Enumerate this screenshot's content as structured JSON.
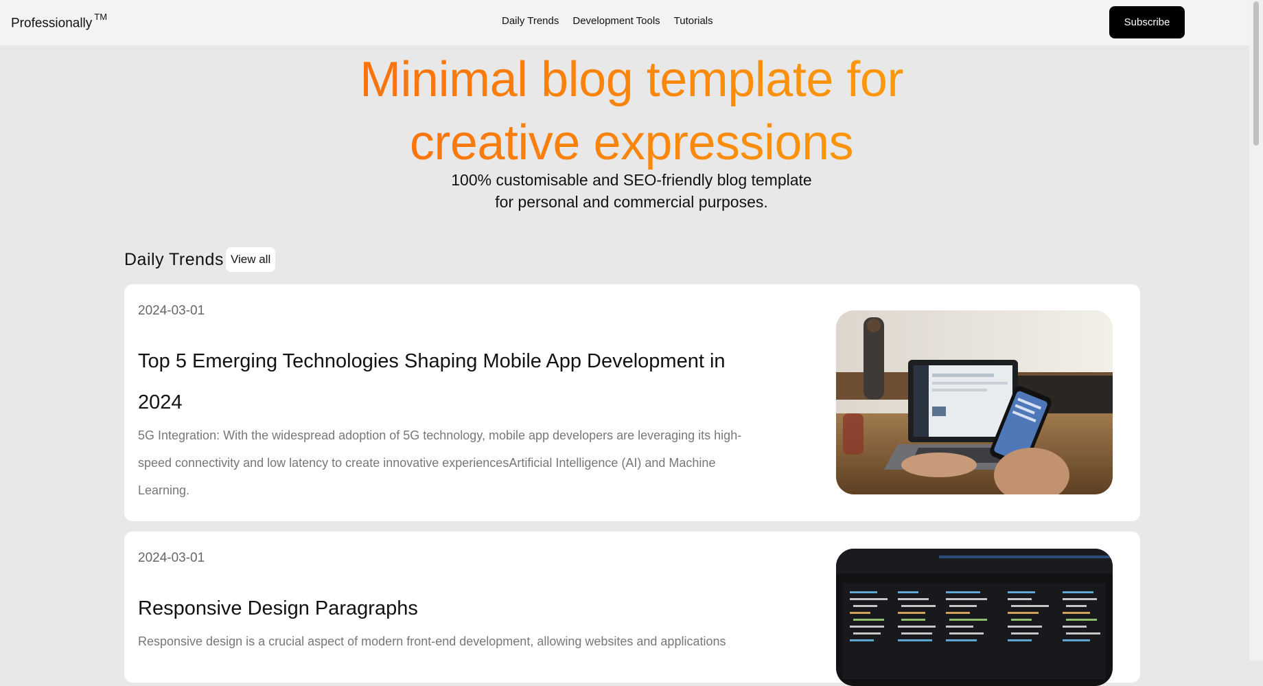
{
  "nav": {
    "brand": "Professionally",
    "brand_mark": "TM",
    "links": [
      "Daily Trends",
      "Development Tools",
      "Tutorials"
    ],
    "subscribe_label": "Subscribe"
  },
  "hero": {
    "title_line1": "Minimal blog template for",
    "title_line2": "creative expressions",
    "subtitle_line1": "100% customisable and SEO-friendly blog template",
    "subtitle_line2": "for personal and commercial purposes."
  },
  "section": {
    "title": "Daily Trends",
    "view_all_label": "View all"
  },
  "posts": [
    {
      "date": "2024-03-01",
      "title": "Top 5 Emerging Technologies Shaping Mobile App Development in 2024",
      "excerpt": "5G Integration: With the widespread adoption of 5G technology, mobile app developers are leveraging its high-speed connectivity and low latency to create innovative experiencesArtificial Intelligence (AI) and Machine Learning.",
      "image": "laptop-and-phone-photo"
    },
    {
      "date": "2024-03-01",
      "title": "Responsive Design Paragraphs",
      "excerpt": "Responsive design is a crucial aspect of modern front-end development, allowing websites and applications",
      "image": "code-screen-photo"
    }
  ],
  "colors": {
    "gradient_start": "#f85a0e",
    "gradient_end": "#fdb409",
    "subscribe_bg": "#000000",
    "page_bg": "#e8e8e8"
  }
}
